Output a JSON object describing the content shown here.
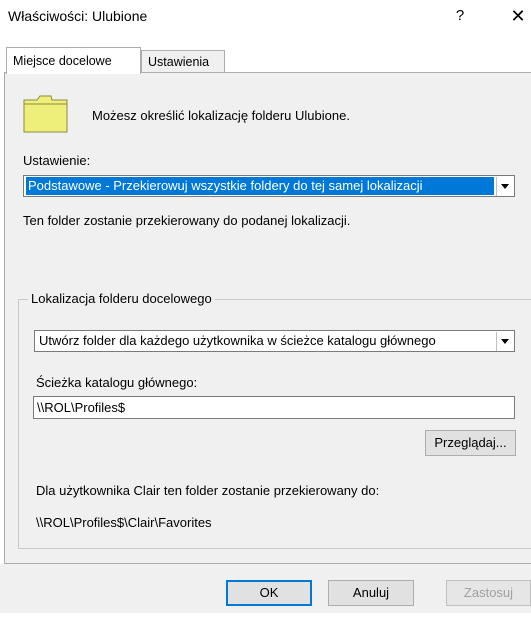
{
  "window": {
    "title": "Właściwości: Ulubione",
    "help": "?",
    "close": "✕"
  },
  "tabs": [
    {
      "label": "Miejsce docelowe",
      "active": true
    },
    {
      "label": "Ustawienia",
      "active": false
    }
  ],
  "intro": "Możesz określić lokalizację folderu Ulubione.",
  "setting": {
    "label": "Ustawienie:",
    "value": "Podstawowe - Przekierowuj wszystkie foldery do tej samej lokalizacji"
  },
  "setting_note": "Ten folder zostanie przekierowany do podanej lokalizacji.",
  "target": {
    "group_title": "Lokalizacja folderu docelowego",
    "mode_value": "Utwórz folder dla każdego użytkownika w ścieżce katalogu głównego",
    "root_label": "Ścieżka katalogu głównego:",
    "root_value": "\\\\ROL\\Profiles$",
    "browse_label": "Przeglądaj...",
    "redirect_note": "Dla użytkownika Clair ten folder zostanie przekierowany do:",
    "redirect_path": "\\\\ROL\\Profiles$\\Clair\\Favorites"
  },
  "buttons": {
    "ok": "OK",
    "cancel": "Anuluj",
    "apply": "Zastosuj"
  },
  "colors": {
    "panel": "#f0f0f0",
    "highlight": "#0078d7",
    "folder": "#eeee7a",
    "folder_border": "#8c8c3c"
  }
}
